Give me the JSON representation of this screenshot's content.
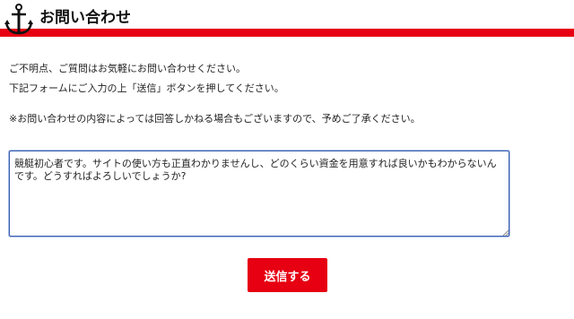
{
  "header": {
    "title": "お問い合わせ",
    "icon": "anchor-icon"
  },
  "intro": {
    "line1": "ご不明点、ご質問はお気軽にお問い合わせください。",
    "line2": "下記フォームにご入力の上「送信」ボタンを押してください。",
    "notice": "※お問い合わせの内容によっては回答しかねる場合もございますので、予めご了承ください。"
  },
  "form": {
    "message_value": "競艇初心者です。サイトの使い方も正直わかりませんし、どのくらい資金を用意すれば良いかもわからないんです。どうすればよろしいでしょうか?",
    "submit_label": "送信する"
  },
  "colors": {
    "accent": "#e60012",
    "textarea_border": "#3a5fb0"
  }
}
